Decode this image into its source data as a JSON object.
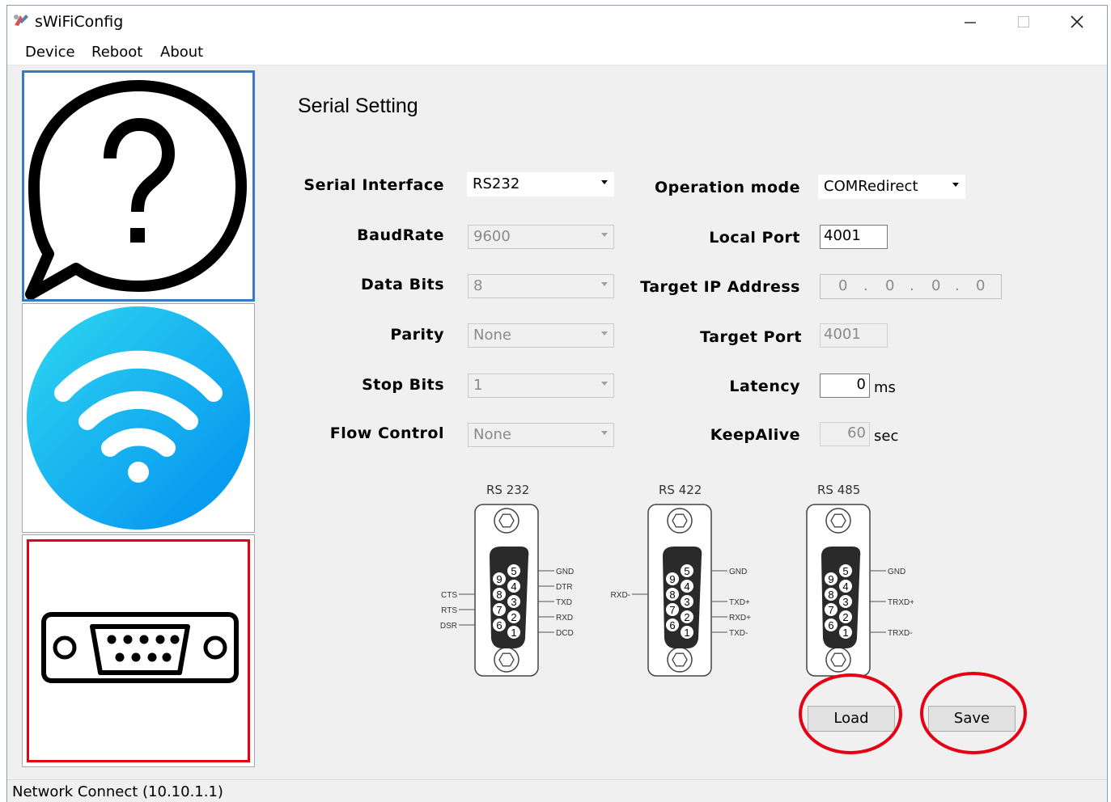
{
  "window": {
    "title": "sWiFiConfig"
  },
  "menu": [
    "Device",
    "Reboot",
    "About"
  ],
  "sidebar": [
    {
      "name": "help"
    },
    {
      "name": "wifi"
    },
    {
      "name": "serial",
      "selected": true
    }
  ],
  "main": {
    "heading": "Serial Setting",
    "left_fields": {
      "serial_interface": {
        "label": "Serial Interface",
        "value": "RS232"
      },
      "baudrate": {
        "label": "BaudRate",
        "value": "9600"
      },
      "data_bits": {
        "label": "Data Bits",
        "value": "8"
      },
      "parity": {
        "label": "Parity",
        "value": "None"
      },
      "stop_bits": {
        "label": "Stop Bits",
        "value": "1"
      },
      "flow_control": {
        "label": "Flow Control",
        "value": "None"
      }
    },
    "right_fields": {
      "operation_mode": {
        "label": "Operation mode",
        "value": "COMRedirect"
      },
      "local_port": {
        "label": "Local Port",
        "value": "4001"
      },
      "target_ip": {
        "label": "Target IP Address",
        "octets": [
          "0",
          "0",
          "0",
          "0"
        ],
        "dot": "."
      },
      "target_port": {
        "label": "Target Port",
        "value": "4001"
      },
      "latency": {
        "label": "Latency",
        "value": "0",
        "unit": "ms"
      },
      "keepalive": {
        "label": "KeepAlive",
        "value": "60",
        "unit": "sec"
      }
    },
    "connectors": {
      "rs232": {
        "caption": "RS 232",
        "pin_numbers": [
          "5",
          "4",
          "3",
          "2",
          "1",
          "9",
          "8",
          "7",
          "6"
        ],
        "right_signals": [
          "GND",
          "DTR",
          "TXD",
          "RXD",
          "DCD"
        ],
        "left_signals": [
          "CTS",
          "RTS",
          "DSR"
        ]
      },
      "rs422": {
        "caption": "RS 422",
        "pin_numbers": [
          "5",
          "4",
          "3",
          "2",
          "1",
          "9",
          "8",
          "7",
          "6"
        ],
        "right_signals": [
          "GND",
          "TXD+",
          "RXD+",
          "TXD-"
        ],
        "left_signals": [
          "RXD-"
        ]
      },
      "rs485": {
        "caption": "RS 485",
        "pin_numbers": [
          "5",
          "4",
          "3",
          "2",
          "1",
          "9",
          "8",
          "7",
          "6"
        ],
        "right_signals": [
          "GND",
          "TRXD+",
          "TRXD-"
        ]
      }
    },
    "buttons": {
      "load": "Load",
      "save": "Save"
    },
    "highlight_color": "#e60012"
  },
  "status": "Network Connect (10.10.1.1)",
  "colors": {
    "selected_tile": "#e60012",
    "hover_tile": "#3a78c2",
    "wifi_blue": "#00b4f0"
  }
}
